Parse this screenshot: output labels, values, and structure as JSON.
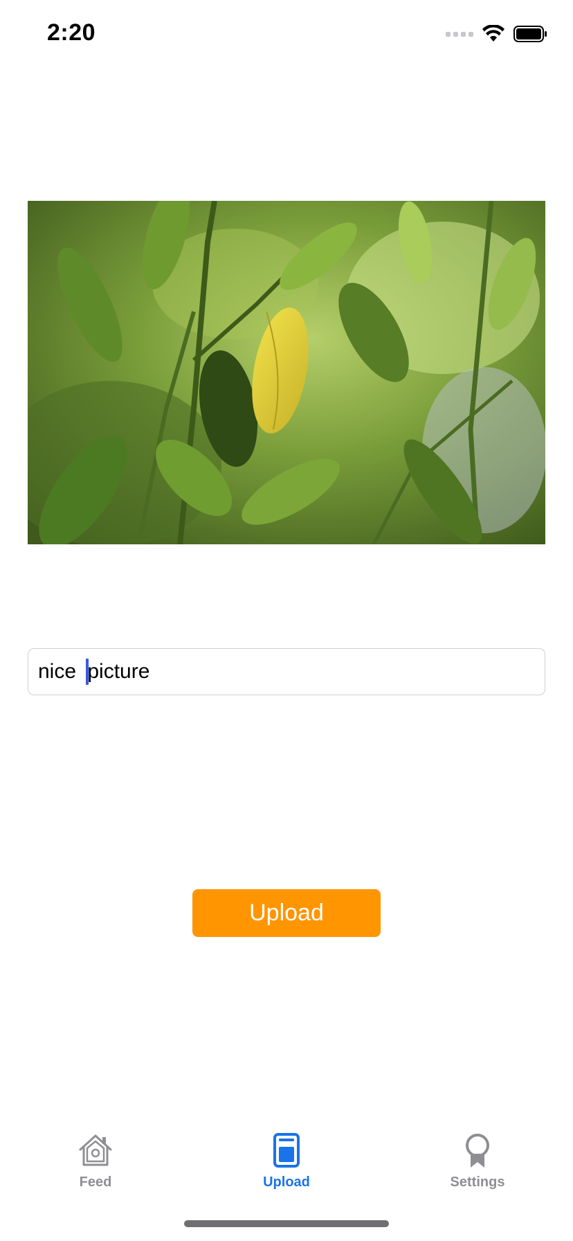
{
  "status_bar": {
    "time": "2:20",
    "icons": [
      "signal-icon",
      "wifi-icon",
      "battery-icon"
    ]
  },
  "photo": {
    "subject": "leafy-plant-photo",
    "colors": {
      "leaf_dark": "#4b6b1f",
      "leaf_light": "#9cc24a",
      "yellow_leaf": "#e2d23c"
    }
  },
  "caption_input": {
    "value_before_cursor": "nice ",
    "value_after_cursor": "picture"
  },
  "upload_button": {
    "label": "Upload",
    "color": "#ff9500"
  },
  "tab_bar": {
    "active_color": "#1a73e8",
    "inactive_color": "#8e8e93",
    "tabs": [
      {
        "label": "Feed",
        "icon": "house-icon",
        "active": false
      },
      {
        "label": "Upload",
        "icon": "document-icon",
        "active": true
      },
      {
        "label": "Settings",
        "icon": "award-icon",
        "active": false
      }
    ]
  }
}
